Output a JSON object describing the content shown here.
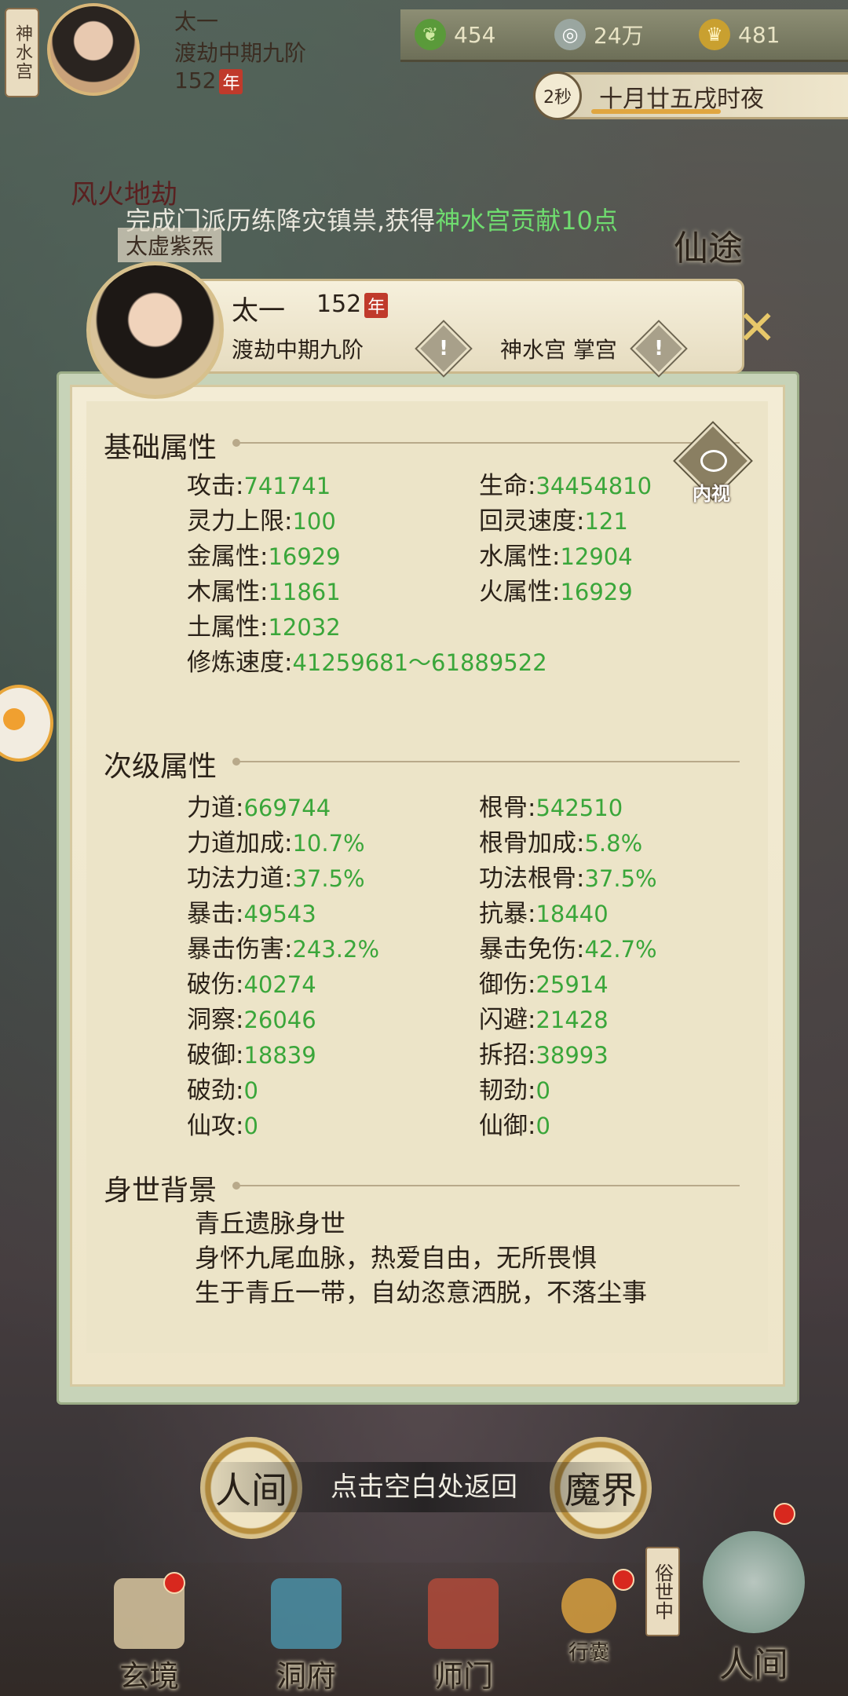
{
  "top": {
    "sect_tag": "神水宫",
    "player_name": "太一",
    "realm": "渡劫中期九阶",
    "age": "152",
    "year_unit": "年",
    "resources": [
      {
        "icon": "leaf-icon",
        "value": "454"
      },
      {
        "icon": "coin-icon",
        "value": "24万"
      },
      {
        "icon": "ingot-icon",
        "value": "481"
      }
    ],
    "timer_seconds": "2秒",
    "game_date": "十月廿五戌时夜",
    "time_progress": 0.55
  },
  "event": {
    "title": "风火地劫",
    "message_prefix": "完成门派历练降灾镇祟,获得",
    "message_highlight": "神水宫贡献10点",
    "location": "太虚紫炁",
    "side_label": "仙途"
  },
  "dialog": {
    "name": "太一",
    "age": "152",
    "year_unit": "年",
    "realm": "渡劫中期九阶",
    "sect_role": "神水宫 掌宫",
    "inner_view_label": "内视",
    "basic_title": "基础属性",
    "basic_stats": [
      {
        "label": "攻击:",
        "value": "741741"
      },
      {
        "label": "生命:",
        "value": "34454810"
      },
      {
        "label": "灵力上限:",
        "value": "100"
      },
      {
        "label": "回灵速度:",
        "value": "121"
      },
      {
        "label": "金属性:",
        "value": "16929"
      },
      {
        "label": "水属性:",
        "value": "12904"
      },
      {
        "label": "木属性:",
        "value": "11861"
      },
      {
        "label": "火属性:",
        "value": "16929"
      },
      {
        "label": "土属性:",
        "value": "12032"
      },
      {
        "label": "修炼速度:",
        "value": "41259681～61889522"
      }
    ],
    "secondary_title": "次级属性",
    "secondary_stats": [
      {
        "label": "力道:",
        "value": "669744"
      },
      {
        "label": "根骨:",
        "value": "542510"
      },
      {
        "label": "力道加成:",
        "value": "10.7%"
      },
      {
        "label": "根骨加成:",
        "value": "5.8%"
      },
      {
        "label": "功法力道:",
        "value": "37.5%"
      },
      {
        "label": "功法根骨:",
        "value": "37.5%"
      },
      {
        "label": "暴击:",
        "value": "49543"
      },
      {
        "label": "抗暴:",
        "value": "18440"
      },
      {
        "label": "暴击伤害:",
        "value": "243.2%"
      },
      {
        "label": "暴击免伤:",
        "value": "42.7%"
      },
      {
        "label": "破伤:",
        "value": "40274"
      },
      {
        "label": "御伤:",
        "value": "25914"
      },
      {
        "label": "洞察:",
        "value": "26046"
      },
      {
        "label": "闪避:",
        "value": "21428"
      },
      {
        "label": "破御:",
        "value": "18839"
      },
      {
        "label": "拆招:",
        "value": "38993"
      },
      {
        "label": "破劲:",
        "value": "0"
      },
      {
        "label": "韧劲:",
        "value": "0"
      },
      {
        "label": "仙攻:",
        "value": "0"
      },
      {
        "label": "仙御:",
        "value": "0"
      }
    ],
    "background_title": "身世背景",
    "background_lines": [
      "青丘遗脉身世",
      "身怀九尾血脉，热爱自由，无所畏惧",
      "生于青丘一带，自幼恣意洒脱，不落尘事"
    ]
  },
  "bottom": {
    "return_hint": "点击空白处返回",
    "realm_left": "人间",
    "realm_right": "魔界",
    "nav": [
      "玄境",
      "洞府",
      "师门",
      "行囊",
      "人间"
    ],
    "world_tag": "俗世中"
  }
}
